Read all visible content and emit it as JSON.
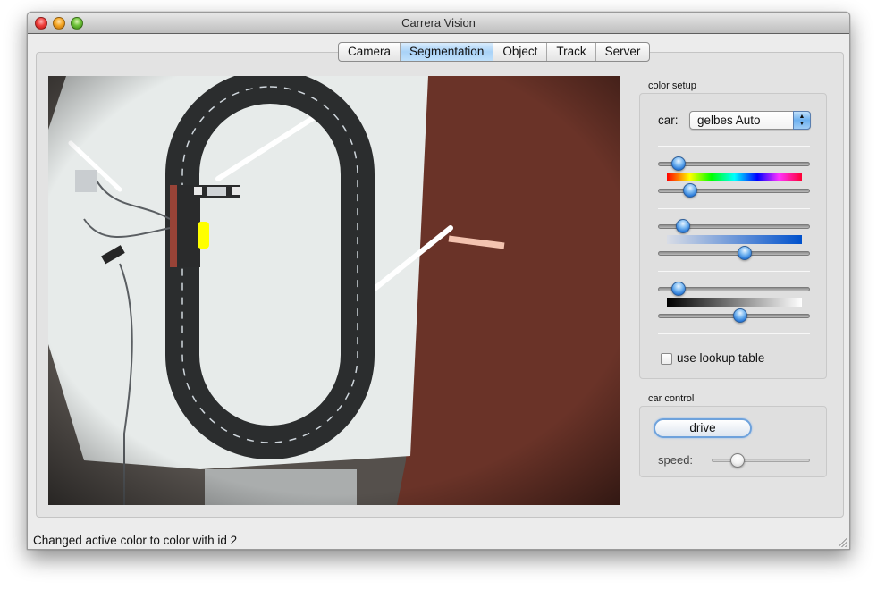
{
  "window": {
    "title": "Carrera Vision",
    "controls": [
      "close",
      "minimize",
      "zoom"
    ]
  },
  "tabs": [
    {
      "label": "Camera",
      "active": false
    },
    {
      "label": "Segmentation",
      "active": true
    },
    {
      "label": "Object",
      "active": false
    },
    {
      "label": "Track",
      "active": false
    },
    {
      "label": "Server",
      "active": false
    }
  ],
  "camera_view": {
    "description": "Overhead camera image of Carrera slot-car oval track; segmented yellow car highlighted",
    "highlight_color": "#ffff00"
  },
  "color_setup": {
    "title": "color setup",
    "car_label": "car:",
    "car_select_value": "gelbes Auto",
    "hue": {
      "min": 0.13,
      "max": 0.21,
      "gradient": "hue"
    },
    "saturation": {
      "min": 0.16,
      "max": 0.57,
      "gradient": "saturation"
    },
    "value": {
      "min": 0.13,
      "max": 0.54,
      "gradient": "brightness"
    },
    "lookup_table": {
      "label": "use lookup table",
      "checked": false
    }
  },
  "car_control": {
    "title": "car control",
    "drive_label": "drive",
    "speed_label": "speed:",
    "speed": 0.26
  },
  "status": {
    "message": "Changed active color to color with id 2"
  },
  "colors": {
    "accent_blue": "#6cb0ef",
    "tab_active": "#a9d2f7"
  }
}
